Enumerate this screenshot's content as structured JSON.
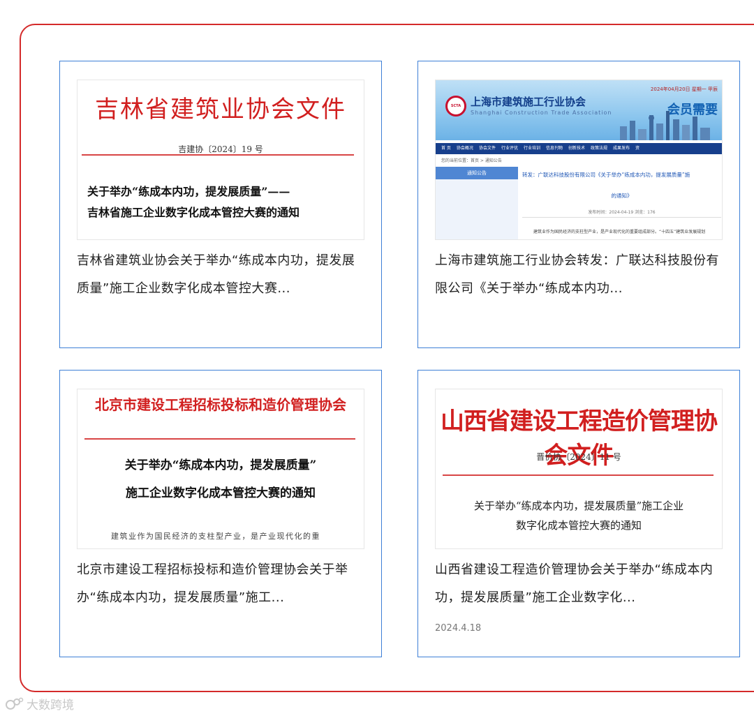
{
  "cards": [
    {
      "caption": "吉林省建筑业协会关于举办“练成本内功，提发展质量”施工企业数字化成本管控大赛...",
      "thumb": {
        "header": "吉林省建筑业协会文件",
        "doc_number": "吉建协〔2024〕19 号",
        "subject_line1": "关于举办“练成本内功，提发展质量”——",
        "subject_line2": "吉林省施工企业数字化成本管控大赛的通知"
      }
    },
    {
      "caption": "上海市建筑施工行业协会转发：广联达科技股份有限公司《关于举办“练成本内功...",
      "thumb": {
        "site_name": "上海市建筑施工行业协会",
        "site_name_en": "Shanghai Construction Trade Association",
        "logo_text": "SCTA",
        "date_text": "2024年04月20日 星期一 甲辰",
        "slogan": "会员需要",
        "nav": [
          "首 页",
          "协会概况",
          "协会文件",
          "行业评优",
          "行业培训",
          "信息刊物",
          "创新技术",
          "政策法规",
          "成果发布",
          "资"
        ],
        "breadcrumb": "您的当前位置：首页 > 通知公告",
        "sidebar_title": "通知公告",
        "article_title": "转发：广联达科技股份有限公司《关于举办“练成本内功，提发展质量”施",
        "article_title2": "的通知》",
        "meta": "发布时间：2024-04-19    浏览：176",
        "body": "建筑业作为国民经济的支柱型产业，是产业现代化的重要组成部分。“十四五”建筑业发展规划"
      }
    },
    {
      "caption": "北京市建设工程招标投标和造价管理协会关于举办“练成本内功，提发展质量”施工...",
      "thumb": {
        "header": "北京市建设工程招标投标和造价管理协会",
        "subject_line1": "关于举办“练成本内功，提发展质量”",
        "subject_line2": "施工企业数字化成本管控大赛的通知",
        "body": "建筑业作为国民经济的支柱型产业，是产业现代化的重"
      }
    },
    {
      "caption": "山西省建设工程造价管理协会关于举办“练成本内功，提发展质量”施工企业数字化...",
      "date": "2024.4.18",
      "thumb": {
        "header": "山西省建设工程造价管理协会文件",
        "doc_number": "晋价协〔2024〕11 号",
        "subject_line1": "关于举办“练成本内功，提发展质量”施工企业",
        "subject_line2": "数字化成本管控大赛的通知"
      }
    }
  ],
  "watermark": {
    "text": "大数跨境"
  },
  "colors": {
    "accent_red": "#d42a2a",
    "card_border": "#3d7fd6"
  }
}
